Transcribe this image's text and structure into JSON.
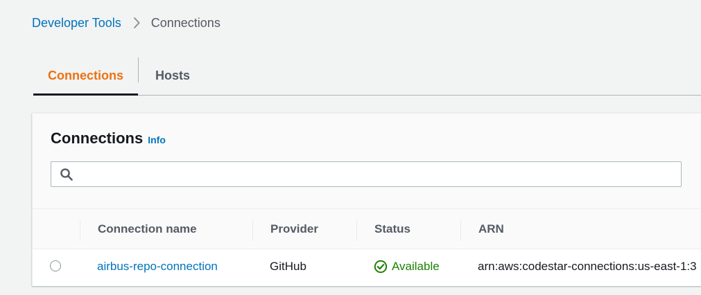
{
  "breadcrumb": {
    "parent": "Developer Tools",
    "current": "Connections"
  },
  "tabs": [
    {
      "label": "Connections",
      "active": true
    },
    {
      "label": "Hosts",
      "active": false
    }
  ],
  "panel": {
    "title": "Connections",
    "info_label": "Info",
    "search": {
      "value": "",
      "placeholder": ""
    }
  },
  "table": {
    "columns": [
      "Connection name",
      "Provider",
      "Status",
      "ARN"
    ],
    "rows": [
      {
        "selected": false,
        "name": "airbus-repo-connection",
        "provider": "GitHub",
        "status": "Available",
        "arn": "arn:aws:codestar-connections:us-east-1:3"
      }
    ]
  },
  "colors": {
    "link": "#0073bb",
    "active_tab": "#ec7211",
    "status_available": "#1d8102"
  },
  "icons": [
    "chevron-right-icon",
    "search-icon",
    "check-circle-icon"
  ]
}
